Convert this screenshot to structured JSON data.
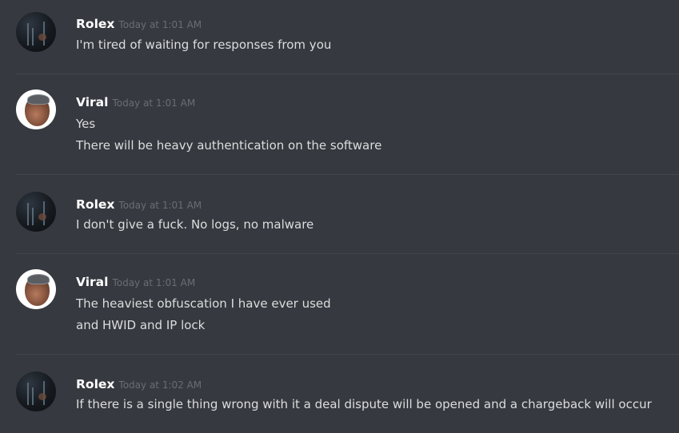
{
  "messages": [
    {
      "author": "Rolex",
      "timestamp": "Today at 1:01 AM",
      "avatar": "rolex-avatar",
      "lines": [
        "I'm tired of waiting for responses from you"
      ]
    },
    {
      "author": "Viral",
      "timestamp": "Today at 1:01 AM",
      "avatar": "viral-avatar",
      "lines": [
        "Yes",
        "There will be heavy authentication on the software"
      ]
    },
    {
      "author": "Rolex",
      "timestamp": "Today at 1:01 AM",
      "avatar": "rolex-avatar",
      "lines": [
        "I don't give a fuck. No logs, no malware"
      ]
    },
    {
      "author": "Viral",
      "timestamp": "Today at 1:01 AM",
      "avatar": "viral-avatar",
      "lines": [
        "The heaviest obfuscation I have ever used",
        "and HWID and IP lock"
      ]
    },
    {
      "author": "Rolex",
      "timestamp": "Today at 1:02 AM",
      "avatar": "rolex-avatar",
      "lines": [
        "If there is a single thing wrong with it a deal dispute will be opened and a chargeback will occur"
      ]
    }
  ],
  "colors": {
    "background": "#36393f",
    "username": "#ffffff",
    "timestamp": "#6a6e74",
    "message_text": "#dcddde",
    "divider": "#42454a"
  }
}
